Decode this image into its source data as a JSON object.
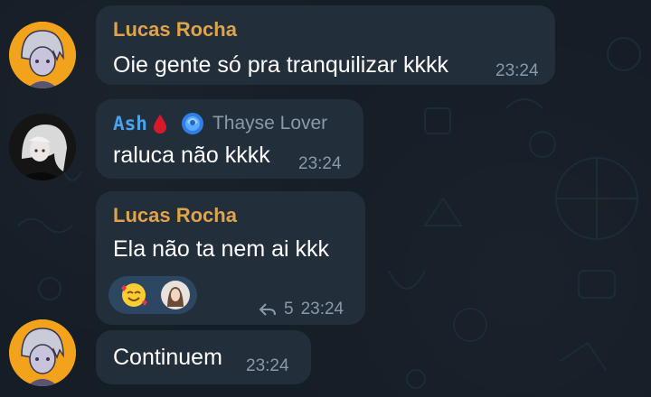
{
  "colors": {
    "background": "#151d26",
    "bubble": "#222e3a",
    "sender_orange": "#e0a34a",
    "sender_blue": "#4aa3f0",
    "muted": "#8a98a8",
    "reaction_bg": "#2d4762"
  },
  "messages": [
    {
      "sender": "Lucas Rocha",
      "text": "Oie gente só pra tranquilizar kkkk",
      "time": "23:24",
      "avatar": "anime-boy-avatar"
    },
    {
      "sender": "Ash",
      "sender_badges": [
        "blood-drop-icon",
        "blue-rose-icon"
      ],
      "sender_title": "Thayse Lover",
      "text": "raluca não kkkk",
      "time": "23:24",
      "avatar": "dark-girl-avatar"
    },
    {
      "sender": "Lucas Rocha",
      "text": "Ela não ta nem ai kkk",
      "time": "23:24",
      "reactions": [
        "smiling-face-with-hearts-emoji",
        "reactor-avatar"
      ],
      "reply_count": "5"
    },
    {
      "text": "Continuem",
      "time": "23:24",
      "avatar": "anime-boy-avatar"
    }
  ]
}
